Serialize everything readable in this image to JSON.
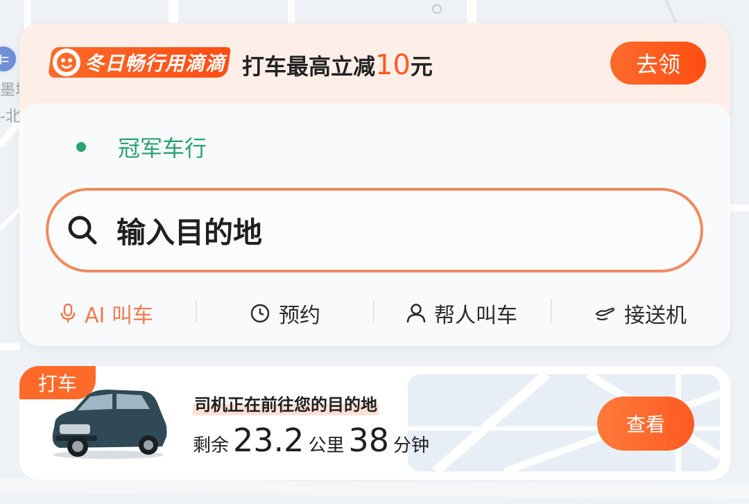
{
  "map": {
    "labels": [
      "墨城",
      "-北"
    ],
    "nav_icon": "exit-icon"
  },
  "promo": {
    "badge_text": "冬日畅行用滴滴",
    "text_prefix": "打车最高立减",
    "amount": "10",
    "text_suffix": "元",
    "claim_label": "去领"
  },
  "origin": {
    "label": "冠军车行",
    "dot_color": "#27a46b"
  },
  "search": {
    "placeholder": "输入目的地",
    "icon": "search-icon"
  },
  "actions": [
    {
      "label": "AI 叫车",
      "icon": "microphone-icon"
    },
    {
      "label": "预约",
      "icon": "clock-icon"
    },
    {
      "label": "帮人叫车",
      "icon": "person-icon"
    },
    {
      "label": "接送机",
      "icon": "airplane-icon"
    }
  ],
  "trip": {
    "tag": "打车",
    "status": "司机正在前往您的目的地",
    "remaining_label": "剩余",
    "distance": "23.2",
    "distance_unit": "公里",
    "minutes": "38",
    "minutes_unit": "分钟",
    "view_label": "查看"
  },
  "colors": {
    "accent": "#ff5a1f",
    "origin_green": "#2aa070",
    "search_border": "#f08a5d"
  }
}
